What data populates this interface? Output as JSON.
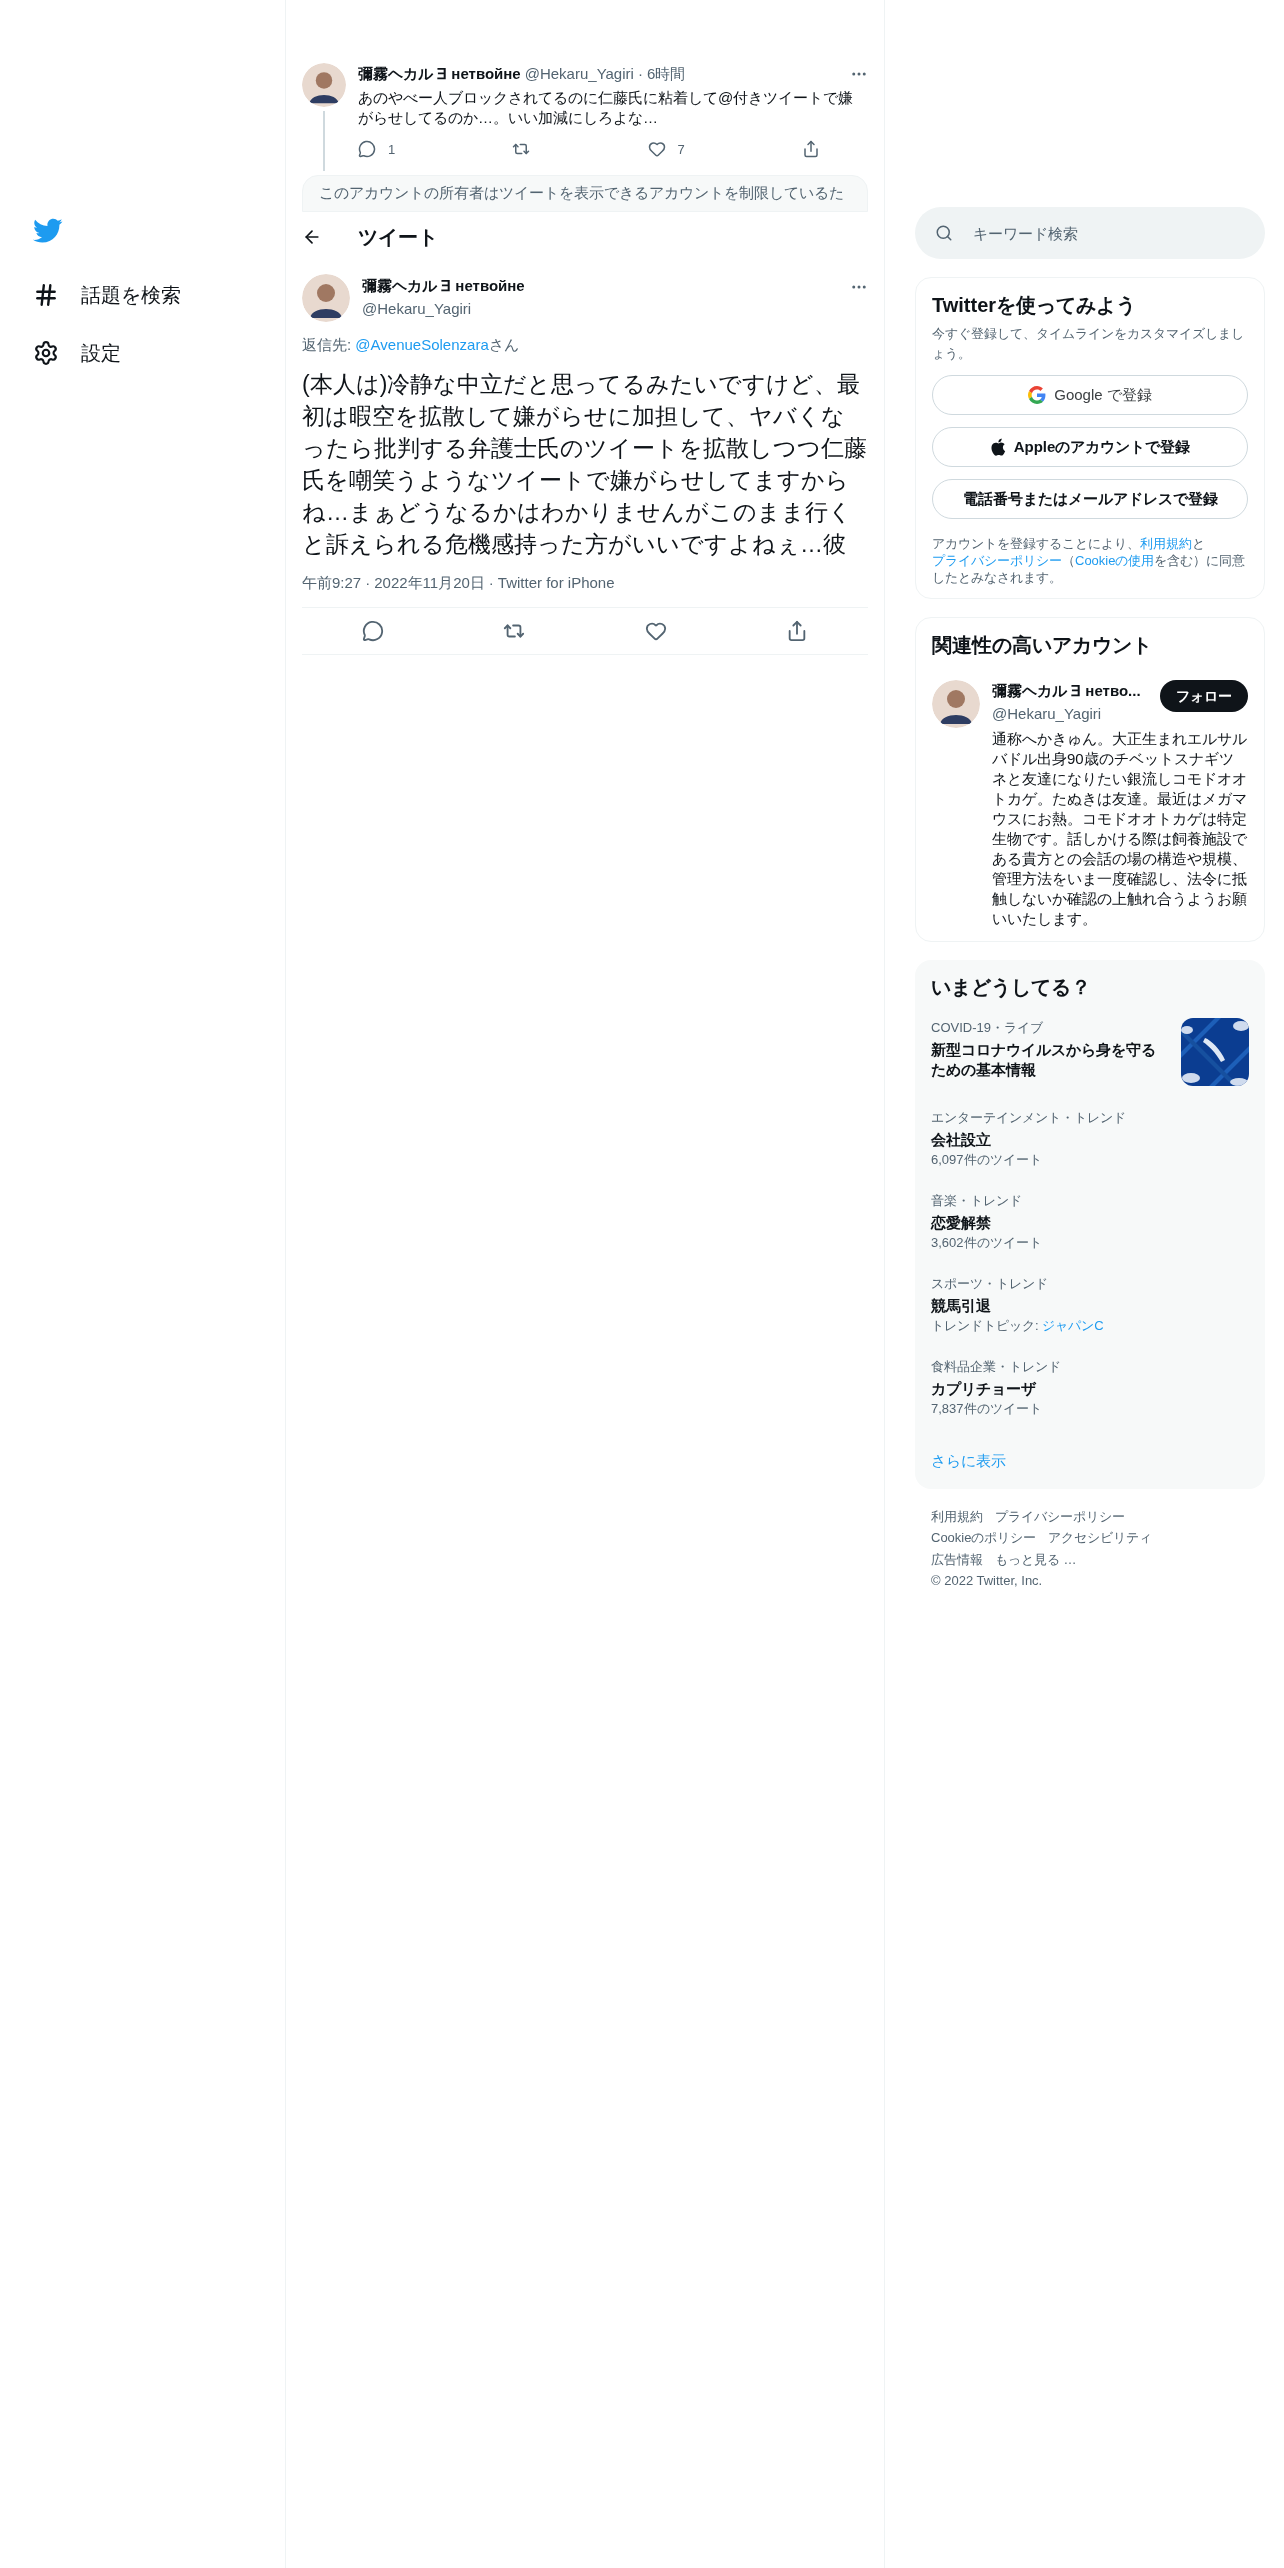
{
  "sidebar": {
    "items": [
      {
        "kind": "hashtag",
        "label": "話題を検索"
      },
      {
        "kind": "settings",
        "label": "設定"
      }
    ]
  },
  "thread": {
    "parent": {
      "name": "彌霧ヘカル ∃ нетвойне",
      "handle": "@Hekaru_Yagiri",
      "time": "6時間",
      "separator": "·",
      "text": "あのやべー人ブロックされてるのに仁藤氏に粘着して@付きツイートで嫌がらせしてるのか…。いい加減にしろよな…",
      "replies": "1",
      "likes": "7"
    },
    "notice": "このアカウントの所有者はツイートを表示できるアカウントを制限しているた",
    "header": {
      "title": "ツイート"
    },
    "tweet": {
      "name": "彌霧ヘカル ∃ нетвойне",
      "handle": "@Hekaru_Yagiri",
      "reply_label": "返信先: ",
      "reply_to": "@AvenueSolenzara",
      "reply_suffix": "さん",
      "text": "(本人は)冷静な中立だと思ってるみたいですけど、最初は暇空を拡散して嫌がらせに加担して、ヤバくなったら批判する弁護士氏のツイートを拡散しつつ仁藤氏を嘲笑うようなツイートで嫌がらせしてますからね…まぁどうなるかはわかりませんがこのまま行くと訴えられる危機感持った方がいいですよねぇ…彼",
      "time": "午前9:27",
      "separator": "·",
      "date": "2022年11月20日",
      "source": "Twitter for iPhone"
    }
  },
  "search": {
    "placeholder": "キーワード検索"
  },
  "signup": {
    "title": "Twitterを使ってみよう",
    "subtitle": "今すぐ登録して、タイムラインをカスタマイズしましょう。",
    "buttons": [
      {
        "kind": "google",
        "label": "Google で登録"
      },
      {
        "kind": "apple",
        "label": "Appleのアカウントで登録"
      },
      {
        "kind": "plain",
        "label": "電話番号またはメールアドレスで登録"
      }
    ],
    "terms": [
      {
        "text": "アカウントを登録することにより、",
        "link": false
      },
      {
        "text": "利用規約",
        "link": true
      },
      {
        "text": "と",
        "link": false
      },
      {
        "text": "プライバシーポリシー",
        "link": true
      },
      {
        "text": "（",
        "link": false
      },
      {
        "text": "Cookieの使用",
        "link": true
      },
      {
        "text": "を含む）に同意したとみなされます。",
        "link": false
      }
    ]
  },
  "related": {
    "title": "関連性の高いアカウント",
    "account": {
      "name": "彌霧ヘカル ∃ нетво...",
      "handle": "@Hekaru_Yagiri",
      "follow": "フォロー",
      "bio": "通称へかきゅん。大正生まれエルサルバドル出身90歳のチベットスナギツネと友達になりたい銀流しコモドオオトカゲ。たぬきは友達。最近はメガマウスにお熱。コモドオオトカゲは特定生物です。話しかける際は飼養施設である貴方との会話の場の構造や規模、管理方法をいま一度確認し、法令に抵触しないか確認の上触れ合うようお願いいたします。"
    }
  },
  "trends": {
    "title": "いまどうしてる？",
    "items": [
      {
        "kind": "live",
        "category": "COVID-19・ライブ",
        "title": "新型コロナウイルスから身を守るための基本情報"
      },
      {
        "kind": "count",
        "category": "エンターテインメント・トレンド",
        "title": "会社設立",
        "meta": "6,097件のツイート"
      },
      {
        "kind": "count",
        "category": "音楽・トレンド",
        "title": "恋愛解禁",
        "meta": "3,602件のツイート"
      },
      {
        "kind": "topic",
        "category": "スポーツ・トレンド",
        "title": "競馬引退",
        "meta": "トレンドトピック: ",
        "topic": "ジャパンC"
      },
      {
        "kind": "count",
        "category": "食料品企業・トレンド",
        "title": "カプリチョーザ",
        "meta": "7,837件のツイート"
      }
    ],
    "more": "さらに表示"
  },
  "footer": {
    "links": [
      "利用規約",
      "プライバシーポリシー",
      "Cookieのポリシー",
      "アクセシビリティ",
      "広告情報",
      "もっと見る …"
    ],
    "copyright": "© 2022 Twitter, Inc."
  }
}
